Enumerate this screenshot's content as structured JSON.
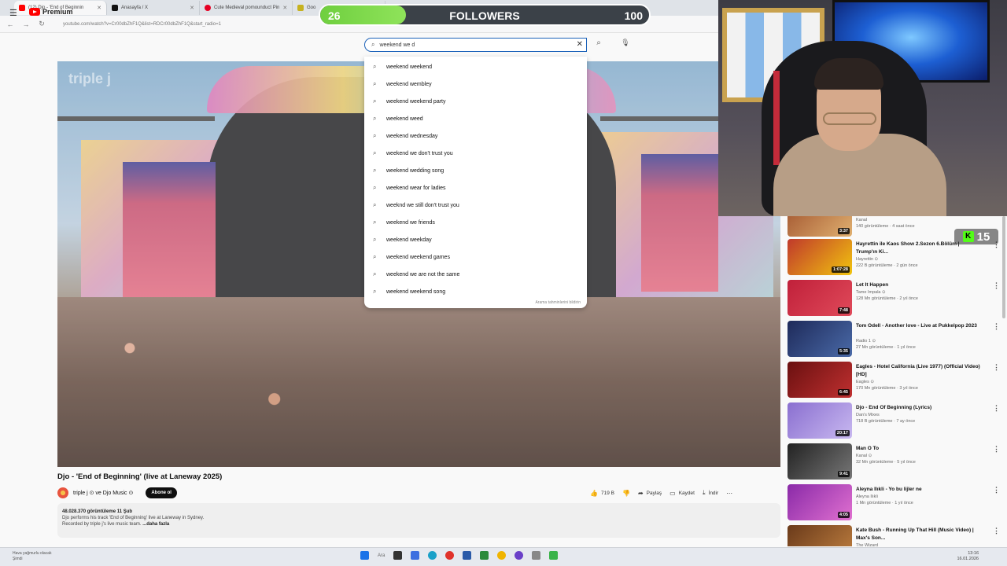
{
  "browser": {
    "tabs": [
      {
        "label": "(12) Djo - 'End of Beginnin",
        "color": "#ff0000",
        "active": true
      },
      {
        "label": "Anasayfa / X",
        "color": "#111111",
        "active": false
      },
      {
        "label": "Cute Medieval pomounduct Pin",
        "color": "#e60023",
        "active": false
      },
      {
        "label": "Goo",
        "color": "#3c3c3c",
        "active": false
      }
    ],
    "url": "youtube.com/watch?v=Cr00dbZhF1Q&list=RDCr00dbZhF1Q&start_radio=1"
  },
  "youtube": {
    "logo_text": "Premium",
    "search_query": "weekend we d",
    "suggestions": [
      "weekend weekend",
      "weekend wembley",
      "weekend weekend party",
      "weekend weed",
      "weekend wednesday",
      "weekend we don't trust you",
      "weekend wedding song",
      "weekend wear for ladies",
      "weeknd we still don't trust you",
      "weekend we friends",
      "weekend weekday",
      "weekend weekend games",
      "weekend we are not the same",
      "weekend weekend song"
    ],
    "report_text": "Arama tahminlerini bildirin",
    "watermark": "triple j"
  },
  "video": {
    "title": "Djo - 'End of Beginning' (live at Laneway 2025)",
    "channel": "triple j ⊙ ve Djo Music ⊙",
    "subscribe": "Abone ol",
    "actions": {
      "likes": "719 B",
      "share": "Paylaş",
      "save": "Kaydet",
      "download": "İndir"
    },
    "description": {
      "stats": "48.028.370 görüntüleme  11 Şub",
      "line1": "Djo performs his track 'End of Beginning' live at Laneway in Sydney.",
      "line2": "Recorded by triple j's live music team.",
      "more": "...daha fazla"
    }
  },
  "overlay": {
    "followers_current": "26",
    "followers_label": "FOLLOWERS",
    "followers_goal": "100",
    "followers_progress": 0.26,
    "kick_count": "15"
  },
  "recommendations": [
    {
      "title": "",
      "channel": "Kanal",
      "meta": "140 görüntüleme · 4 saat önce",
      "duration": "3:37",
      "colors": [
        "#a0522d",
        "#e0b070"
      ]
    },
    {
      "title": "Hayrettin ile Kaos Show 2.Sezon 6.Bölüm | Trump'ın Ki...",
      "channel": "Hayrettin ⊙",
      "meta": "222 B görüntüleme · 2 gün önce",
      "duration": "1:07:28",
      "colors": [
        "#c0392b",
        "#f1c40f"
      ]
    },
    {
      "title": "Let It Happen",
      "channel": "Tame Impala ⊙",
      "meta": "128 Mn görüntüleme · 2 yıl önce",
      "duration": "7:48",
      "colors": [
        "#c0203a",
        "#e04a5a"
      ]
    },
    {
      "title": "Tom Odell - Another love - Live at Pukkelpop 2023",
      "channel": "Radio 1 ⊙",
      "meta": "27 Mn görüntüleme · 1 yıl önce",
      "duration": "5:35",
      "colors": [
        "#1e2a5a",
        "#4a6aa8"
      ]
    },
    {
      "title": "Eagles - Hotel California (Live 1977) (Official Video) [HD]",
      "channel": "Eagles ⊙",
      "meta": "170 Mn görüntüleme · 3 yıl önce",
      "duration": "6:45",
      "colors": [
        "#6a1010",
        "#c03030"
      ]
    },
    {
      "title": "Djo - End Of Beginning (Lyrics)",
      "channel": "Dan's Mixes",
      "meta": "718 B görüntüleme · 7 ay önce",
      "duration": "20:17",
      "colors": [
        "#8a6fd0",
        "#c8b8f0"
      ]
    },
    {
      "title": "Man O To",
      "channel": "Kanal ⊙",
      "meta": "32 Mn görüntüleme · 5 yıl önce",
      "duration": "9:41",
      "colors": [
        "#222222",
        "#777777"
      ]
    },
    {
      "title": "Aleyna Ilıkli - Yo bu lijler ne",
      "channel": "Aleyna Ilıkli",
      "meta": "1 Mn görüntüleme · 1 yıl önce",
      "duration": "4:05",
      "colors": [
        "#8a2aa8",
        "#e070d0"
      ]
    },
    {
      "title": "Kate Bush - Running Up That Hill (Music Video) | Max's Son...",
      "channel": "The Wizard",
      "meta": "",
      "duration": "",
      "colors": [
        "#6a3a1a",
        "#c08040"
      ]
    }
  ],
  "taskbar": {
    "weather_line1": "Hava yağmurlu olacak",
    "weather_line2": "Şimdi",
    "search": "Ara",
    "time": "13:16",
    "date": "16.01.2026"
  }
}
